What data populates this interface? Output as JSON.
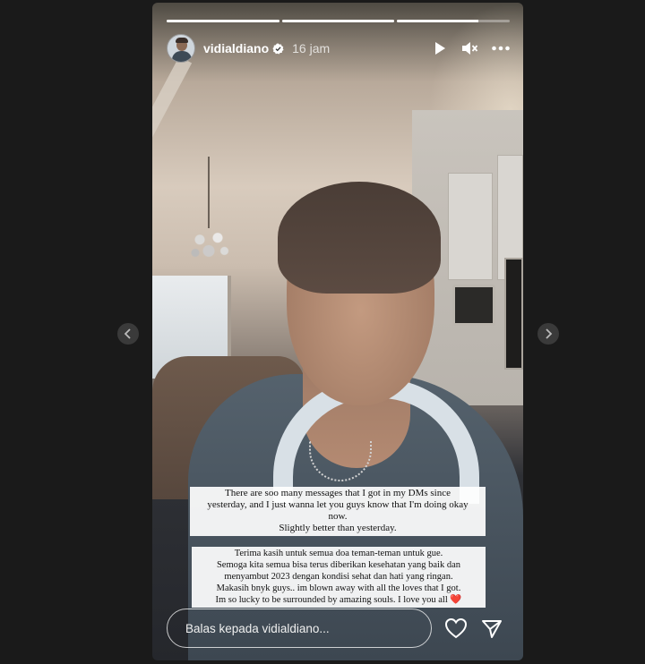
{
  "story": {
    "username": "vidialdiano",
    "time": "16 jam",
    "progress": [
      1.0,
      1.0,
      0.72
    ],
    "captions": {
      "first": [
        "There are soo many messages that I got in my DMs since",
        "yesterday, and I just wanna let you guys know that I'm doing okay",
        "now.",
        "Slightly better than yesterday."
      ],
      "second": [
        "Terima kasih untuk semua doa teman-teman untuk gue.",
        "Semoga kita semua bisa terus diberikan kesehatan yang baik dan",
        "menyambut 2023 dengan kondisi sehat dan hati yang ringan.",
        "Makasih bnyk guys.. im blown away with all the loves that I got.",
        "Im so lucky to be surrounded by amazing souls. I love you all"
      ],
      "heart": "❤️"
    },
    "reply_placeholder": "Balas kepada vidialdiano..."
  },
  "icons": {
    "prev": "chevron-left-icon",
    "next": "chevron-right-icon",
    "play": "play-icon",
    "mute": "mute-icon",
    "more": "more-icon",
    "like": "heart-icon",
    "share": "send-icon",
    "verified": "verified-badge-icon"
  },
  "colors": {
    "background": "#1a1a1a",
    "nav_button": "#3a3a3a",
    "verified": "#ffffff"
  }
}
